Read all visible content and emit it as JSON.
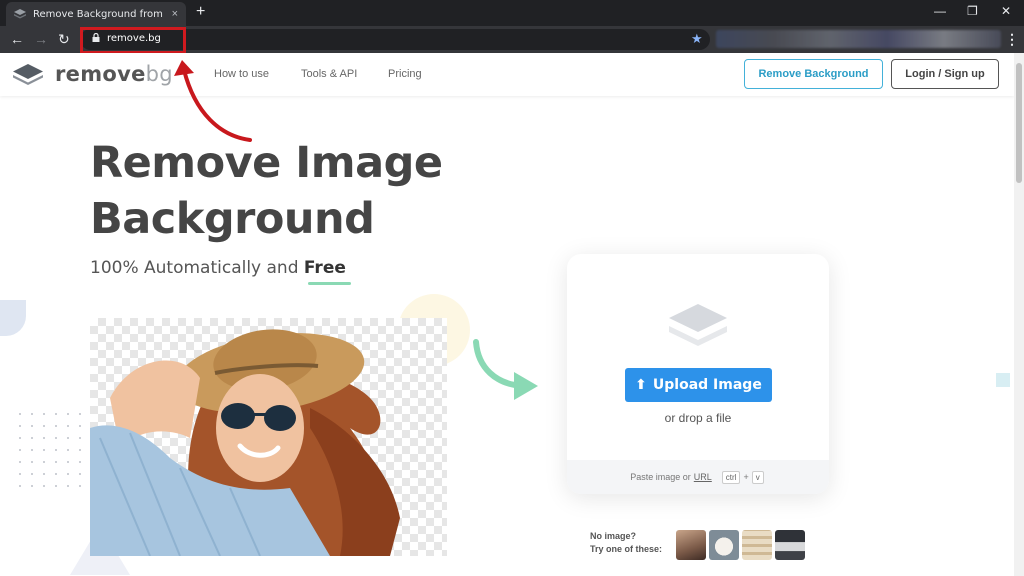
{
  "browser": {
    "tab_title": "Remove Background from Image",
    "url": "remove.bg",
    "new_tab_symbol": "+",
    "tab_close_symbol": "×"
  },
  "site": {
    "logo_main": "remove",
    "logo_suffix": "bg",
    "nav": [
      "How to use",
      "Tools & API",
      "Pricing"
    ],
    "btn_remove_bg": "Remove Background",
    "btn_login": "Login / Sign up"
  },
  "hero": {
    "title": "Remove Image Background",
    "subtitle_prefix": "100% Automatically and ",
    "subtitle_free": "Free"
  },
  "upload": {
    "button": "Upload Image",
    "drop_text": "or drop a file",
    "paste_text": "Paste image or",
    "url_link": "URL",
    "key_ctrl": "ctrl",
    "key_plus": "+",
    "key_v": "v"
  },
  "samples": {
    "line1": "No image?",
    "line2": "Try one of these:"
  },
  "colors": {
    "accent_blue": "#2d92ea",
    "annotation_red": "#d01a1f",
    "arrow_green": "#8ad9b4"
  }
}
